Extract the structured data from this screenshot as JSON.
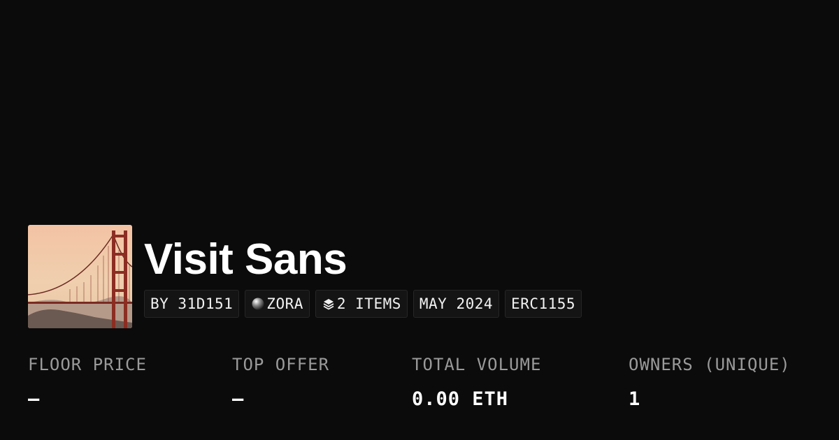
{
  "collection": {
    "title": "Visit Sans",
    "thumbnail_icon": "golden-gate-bridge-image"
  },
  "tags": {
    "creator": "BY 31D151",
    "chain": "ZORA",
    "chain_icon": "zora-orb-icon",
    "items": "2 ITEMS",
    "items_icon": "layers-icon",
    "date": "MAY 2024",
    "standard": "ERC1155"
  },
  "stats": {
    "floor_price_label": "FLOOR PRICE",
    "floor_price_value": "–",
    "top_offer_label": "TOP OFFER",
    "top_offer_value": "–",
    "total_volume_label": "TOTAL VOLUME",
    "total_volume_value": "0.00 ETH",
    "owners_label": "OWNERS (UNIQUE)",
    "owners_value": "1"
  },
  "colors": {
    "background": "#0b0b0b",
    "text": "#ffffff",
    "muted_text": "#9a9a9a"
  }
}
